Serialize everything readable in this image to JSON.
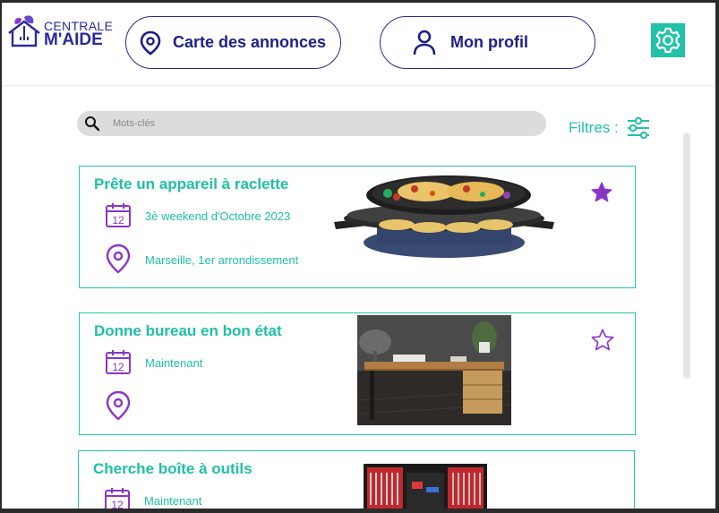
{
  "app": {
    "logo_line1": "CENTRALE",
    "logo_line2": "M'AIDE"
  },
  "nav": {
    "map_label": "Carte des annonces",
    "profile_label": "Mon profil",
    "settings_icon": "gear-icon"
  },
  "search": {
    "placeholder": "Mots-clés",
    "value": ""
  },
  "filters": {
    "label": "Filtres :"
  },
  "colors": {
    "accent": "#22c1a9",
    "brand": "#1d1d8a",
    "icon_purple": "#8a35c9"
  },
  "listings": [
    {
      "title": "Prête un appareil à raclette",
      "date": "3è weekend d'Octobre 2023",
      "location": "Marseille, 1er arrondissement",
      "favorite": true,
      "calendar_day": "12",
      "image": "raclette-grill"
    },
    {
      "title": "Donne bureau en bon état",
      "date": "Maintenant",
      "location": "",
      "favorite": false,
      "calendar_day": "12",
      "image": "wooden-desk"
    },
    {
      "title": "Cherche boîte à outils",
      "date": "Maintenant",
      "location": "",
      "favorite": false,
      "calendar_day": "12",
      "image": "toolbox"
    }
  ]
}
